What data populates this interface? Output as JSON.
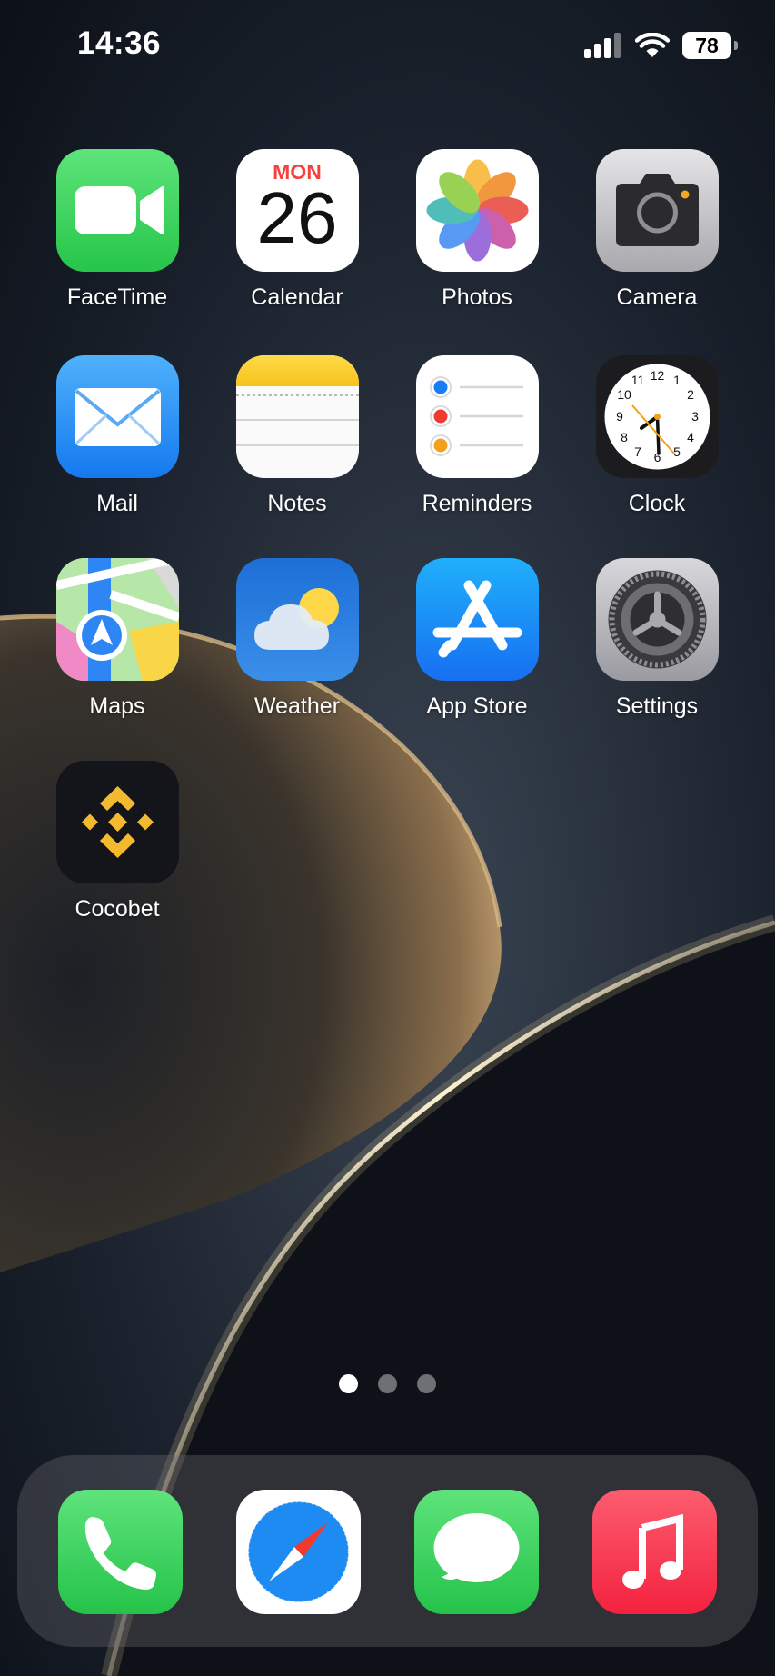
{
  "status_bar": {
    "time": "14:36",
    "battery": "78"
  },
  "apps": [
    {
      "id": "facetime",
      "label": "FaceTime"
    },
    {
      "id": "calendar",
      "label": "Calendar",
      "weekday": "MON",
      "day": "26"
    },
    {
      "id": "photos",
      "label": "Photos"
    },
    {
      "id": "camera",
      "label": "Camera"
    },
    {
      "id": "mail",
      "label": "Mail"
    },
    {
      "id": "notes",
      "label": "Notes"
    },
    {
      "id": "reminders",
      "label": "Reminders"
    },
    {
      "id": "clock",
      "label": "Clock",
      "numbers": [
        "12",
        "1",
        "2",
        "3",
        "4",
        "5",
        "6",
        "7",
        "8",
        "9",
        "10",
        "11"
      ]
    },
    {
      "id": "maps",
      "label": "Maps"
    },
    {
      "id": "weather",
      "label": "Weather"
    },
    {
      "id": "appstore",
      "label": "App Store"
    },
    {
      "id": "settings",
      "label": "Settings"
    },
    {
      "id": "cocobet",
      "label": "Cocobet"
    }
  ],
  "page_indicator": {
    "count": 3,
    "active": 1
  },
  "dock": [
    {
      "id": "phone",
      "icon": "phone-icon"
    },
    {
      "id": "safari",
      "icon": "compass-icon"
    },
    {
      "id": "messages",
      "icon": "speech-bubble-icon"
    },
    {
      "id": "music",
      "icon": "music-note-icon"
    }
  ],
  "colors": {
    "facetime": "#2fd158",
    "mail": "#1f8ef7",
    "appstore": "#1b8cf5",
    "music": "#fa3c52",
    "notes_top": "#fdd12f",
    "cocobet": "#f3ba2f"
  }
}
